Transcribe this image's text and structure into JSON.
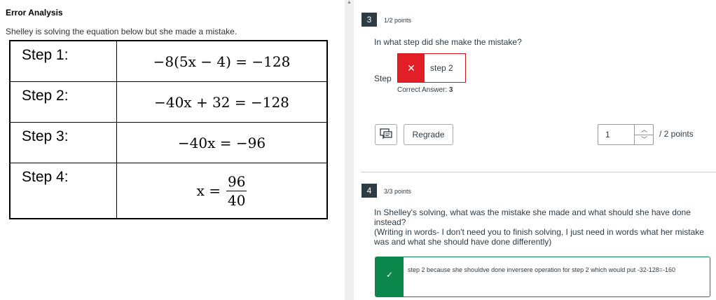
{
  "left": {
    "title": "Error Analysis",
    "description": "Shelley is solving the equation below but she made a mistake.",
    "steps": [
      {
        "label": "Step 1:",
        "equation": "−8(5x − 4) = −128"
      },
      {
        "label": "Step 2:",
        "equation": "−40x + 32 = −128"
      },
      {
        "label": "Step 3:",
        "equation": "−40x = −96"
      },
      {
        "label": "Step 4:",
        "equation_lhs": "x =",
        "numerator": "96",
        "denominator": "40"
      }
    ]
  },
  "q3": {
    "number": "3",
    "points": "1/2 points",
    "question": "In what step did she make the mistake?",
    "step_label": "Step",
    "answer": "step 2",
    "correct_answer_label": "Correct Answer:",
    "correct_answer_value": "3",
    "regrade_label": "Regrade",
    "score_value": "1",
    "score_total": "/ 2 points"
  },
  "q4": {
    "number": "4",
    "points": "3/3 points",
    "question_line1": "In Shelley's solving, what was the mistake she made and what should she have done instead?",
    "question_line2": "(Writing in words- I don't need you to finish solving, I just need in words what her mistake was and what she should have done differently)",
    "answer": "step 2 because she shouldve done inversere operation for step 2 which would put -32-128=-160"
  },
  "icons": {
    "wrong": "close-icon",
    "correct": "checkmark-icon",
    "comment": "comment-icon",
    "spin_up": "chevron-up-icon",
    "spin_down": "chevron-down-icon"
  },
  "colors": {
    "wrong": "#e21f26",
    "correct": "#0b874b",
    "badge": "#2d3b45"
  }
}
